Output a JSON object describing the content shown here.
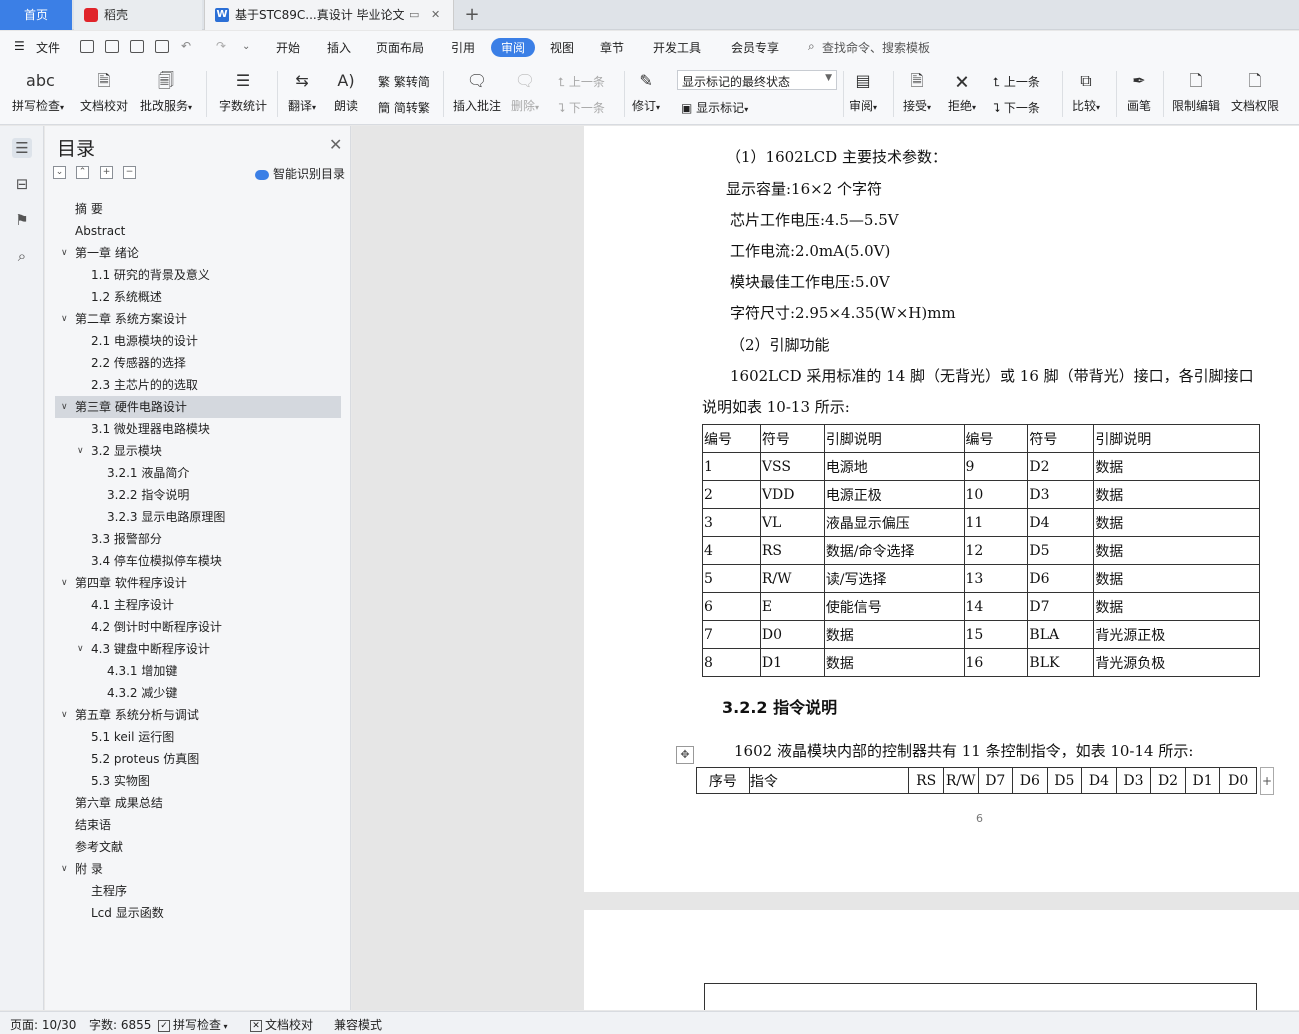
{
  "tabs": {
    "home": "首页",
    "daoke": "稻壳",
    "document": "基于STC89C...真设计 毕业论文",
    "add": "+"
  },
  "menu": {
    "file": "文件",
    "items": [
      "开始",
      "插入",
      "页面布局",
      "引用",
      "审阅",
      "视图",
      "章节",
      "开发工具",
      "会员专享"
    ],
    "active": "审阅",
    "search": "查找命令、搜索模板"
  },
  "ribbon": {
    "spell_check": "拼写检查",
    "doc_check": "文档校对",
    "annotate_service": "批改服务",
    "word_count": "字数统计",
    "translate": "翻译",
    "read_aloud": "朗读",
    "trad_simp": "繁转简",
    "simp_trad": "简转繁",
    "insert_comment": "插入批注",
    "delete": "删除",
    "prev_comment": "上一条",
    "next_comment": "下一条",
    "revise": "修订",
    "markup_dropdown": "显示标记的最终状态",
    "show_markup": "显示标记",
    "review": "审阅",
    "accept": "接受",
    "reject": "拒绝",
    "prev_change": "上一条",
    "next_change": "下一条",
    "compare": "比较",
    "pen": "画笔",
    "restrict_edit": "限制编辑",
    "doc_permission": "文档权限"
  },
  "toc": {
    "title": "目录",
    "smart": "智能识别目录",
    "items": [
      {
        "text": "摘    要",
        "level": 1,
        "arrow": ""
      },
      {
        "text": "Abstract",
        "level": 1,
        "arrow": ""
      },
      {
        "text": "第一章  绪论",
        "level": 1,
        "arrow": "v"
      },
      {
        "text": "1.1 研究的背景及意义",
        "level": 2,
        "arrow": ""
      },
      {
        "text": "1.2 系统概述",
        "level": 2,
        "arrow": ""
      },
      {
        "text": "第二章  系统方案设计",
        "level": 1,
        "arrow": "v"
      },
      {
        "text": "2.1 电源模块的设计",
        "level": 2,
        "arrow": ""
      },
      {
        "text": "2.2 传感器的选择",
        "level": 2,
        "arrow": ""
      },
      {
        "text": "2.3 主芯片的的选取",
        "level": 2,
        "arrow": ""
      },
      {
        "text": "第三章  硬件电路设计",
        "level": 1,
        "arrow": "v",
        "selected": true
      },
      {
        "text": "3.1 微处理器电路模块",
        "level": 2,
        "arrow": ""
      },
      {
        "text": "3.2 显示模块",
        "level": 2,
        "arrow": "v"
      },
      {
        "text": "3.2.1 液晶简介",
        "level": 3,
        "arrow": ""
      },
      {
        "text": "3.2.2 指令说明",
        "level": 3,
        "arrow": ""
      },
      {
        "text": "3.2.3 显示电路原理图",
        "level": 3,
        "arrow": ""
      },
      {
        "text": "3.3 报警部分",
        "level": 2,
        "arrow": ""
      },
      {
        "text": "3.4 停车位模拟停车模块",
        "level": 2,
        "arrow": ""
      },
      {
        "text": "第四章  软件程序设计",
        "level": 1,
        "arrow": "v"
      },
      {
        "text": "4.1 主程序设计",
        "level": 2,
        "arrow": ""
      },
      {
        "text": "4.2 倒计时中断程序设计",
        "level": 2,
        "arrow": ""
      },
      {
        "text": "4.3 键盘中断程序设计",
        "level": 2,
        "arrow": "v"
      },
      {
        "text": "4.3.1 增加键",
        "level": 3,
        "arrow": ""
      },
      {
        "text": "4.3.2 减少键",
        "level": 3,
        "arrow": ""
      },
      {
        "text": "第五章  系统分析与调试",
        "level": 1,
        "arrow": "v"
      },
      {
        "text": "5.1 keil 运行图",
        "level": 2,
        "arrow": ""
      },
      {
        "text": "5.2 proteus 仿真图",
        "level": 2,
        "arrow": ""
      },
      {
        "text": "5.3 实物图",
        "level": 2,
        "arrow": ""
      },
      {
        "text": "第六章  成果总结",
        "level": 1,
        "arrow": ""
      },
      {
        "text": "结束语",
        "level": 1,
        "arrow": ""
      },
      {
        "text": "参考文献",
        "level": 1,
        "arrow": ""
      },
      {
        "text": "附    录",
        "level": 1,
        "arrow": "v"
      },
      {
        "text": "主程序",
        "level": 2,
        "arrow": ""
      },
      {
        "text": "Lcd 显示函数",
        "level": 2,
        "arrow": ""
      }
    ]
  },
  "doc": {
    "p1": "（1）1602LCD 主要技术参数：",
    "p2": "显示容量:16×2 个字符",
    "p3": "芯片工作电压:4.5—5.5V",
    "p4": "工作电流:2.0mA(5.0V)",
    "p5": "模块最佳工作电压:5.0V",
    "p6": "字符尺寸:2.95×4.35(W×H)mm",
    "p7": "（2）引脚功能",
    "p8": "1602LCD 采用标准的 14 脚（无背光）或 16 脚（带背光）接口，各引脚接口",
    "p9": "说明如表 10-13 所示:",
    "pin_table": [
      [
        "编号",
        "符号",
        "引脚说明",
        "编号",
        "符号",
        "引脚说明"
      ],
      [
        "1",
        "VSS",
        "电源地",
        "9",
        "D2",
        "数据"
      ],
      [
        "2",
        "VDD",
        "电源正极",
        "10",
        "D3",
        "数据"
      ],
      [
        "3",
        "VL",
        "液晶显示偏压",
        "11",
        "D4",
        "数据"
      ],
      [
        "4",
        "RS",
        "数据/命令选择",
        "12",
        "D5",
        "数据"
      ],
      [
        "5",
        "R/W",
        "读/写选择",
        "13",
        "D6",
        "数据"
      ],
      [
        "6",
        "E",
        "使能信号",
        "14",
        "D7",
        "数据"
      ],
      [
        "7",
        "D0",
        "数据",
        "15",
        "BLA",
        "背光源正极"
      ],
      [
        "8",
        "D1",
        "数据",
        "16",
        "BLK",
        "背光源负极"
      ]
    ],
    "heading": "3.2.2 指令说明",
    "p10": "1602 液晶模块内部的控制器共有 11 条控制指令，如表 10-14 所示:",
    "cmd_header": [
      "序号",
      "指令",
      "RS",
      "R/W",
      "D7",
      "D6",
      "D5",
      "D4",
      "D3",
      "D2",
      "D1",
      "D0"
    ],
    "page_number": "6"
  },
  "status": {
    "page": "页面: 10/30",
    "words": "字数: 6855",
    "spell": "拼写检查",
    "doc_check": "文档校对",
    "compat": "兼容模式"
  }
}
